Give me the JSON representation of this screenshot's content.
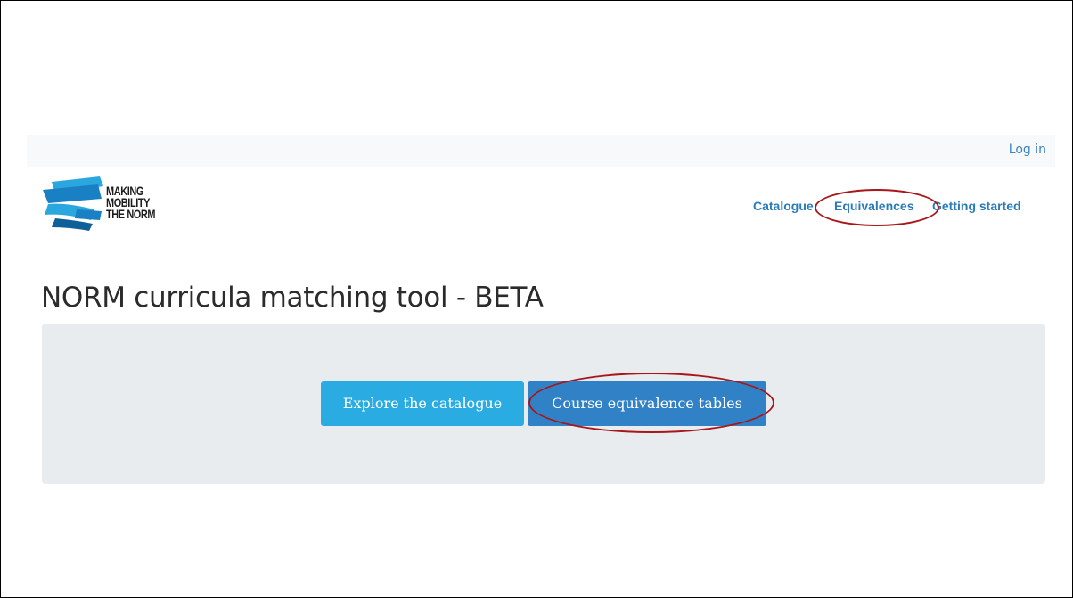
{
  "topbar": {
    "login_label": "Log in"
  },
  "logo": {
    "line1": "MAKING",
    "line2": "MOBILITY",
    "line3": "THE NORM",
    "colors": [
      "#1a80c4",
      "#2aa7de",
      "#0f5f99"
    ]
  },
  "nav": {
    "items": [
      {
        "label": "Catalogue"
      },
      {
        "label": "Equivalences"
      },
      {
        "label": "Getting started"
      }
    ]
  },
  "page": {
    "title": "NORM curricula matching tool - BETA"
  },
  "jumbotron": {
    "explore_label": "Explore the catalogue",
    "courses_label": "Course equivalence tables"
  },
  "colors": {
    "link": "#2a7bb8",
    "explore_button": "#2aabe2",
    "courses_button": "#3181c6",
    "jumbotron_bg": "#e9ecef",
    "annotation": "#a8161a"
  }
}
